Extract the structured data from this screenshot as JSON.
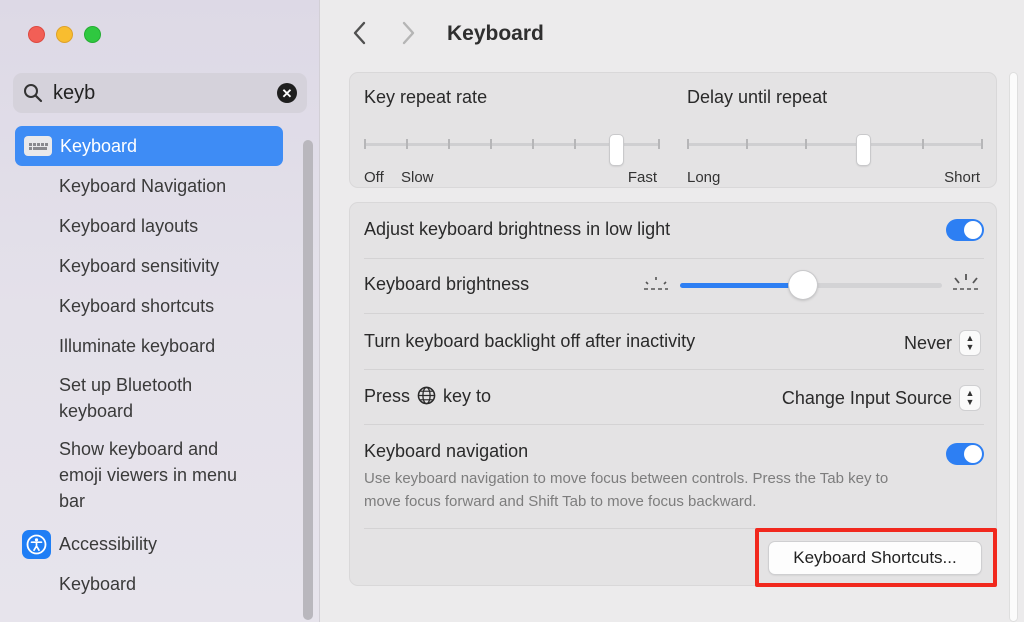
{
  "window": {
    "title": "Keyboard"
  },
  "search": {
    "value": "keyb"
  },
  "sidebar": {
    "selected": {
      "label": "Keyboard"
    },
    "subitems": [
      {
        "label": "Keyboard Navigation"
      },
      {
        "label": "Keyboard layouts"
      },
      {
        "label": "Keyboard sensitivity"
      },
      {
        "label": "Keyboard shortcuts"
      },
      {
        "label": "Illuminate keyboard"
      },
      {
        "label": "Set up Bluetooth keyboard"
      },
      {
        "label": "Show keyboard and emoji viewers in menu bar"
      }
    ],
    "section": {
      "label": "Accessibility",
      "icon": "accessibility-icon"
    },
    "section_subitems": [
      {
        "label": "Keyboard"
      }
    ]
  },
  "key_repeat": {
    "title": "Key repeat rate",
    "labels": {
      "off": "Off",
      "slow": "Slow",
      "fast": "Fast"
    },
    "level_fraction": 0.857
  },
  "delay_repeat": {
    "title": "Delay until repeat",
    "labels": {
      "long": "Long",
      "short": "Short"
    },
    "level_fraction": 0.6
  },
  "settings": {
    "adjust_brightness": {
      "label": "Adjust keyboard brightness in low light",
      "on": true
    },
    "brightness": {
      "label": "Keyboard brightness",
      "level_percent": 47
    },
    "backlight_off": {
      "label": "Turn keyboard backlight off after inactivity",
      "value": "Never"
    },
    "press_key": {
      "label_before": "Press",
      "label_after": "key to",
      "icon": "globe-icon",
      "value": "Change Input Source"
    },
    "keyboard_navigation": {
      "label": "Keyboard navigation",
      "on": true,
      "description": "Use keyboard navigation to move focus between controls. Press the Tab key to move focus forward and Shift Tab to move focus backward."
    },
    "shortcuts_button": {
      "label": "Keyboard Shortcuts..."
    }
  },
  "colors": {
    "accent": "#2d7ff3",
    "selection": "#3e8cf5",
    "highlight": "#f1281d"
  }
}
